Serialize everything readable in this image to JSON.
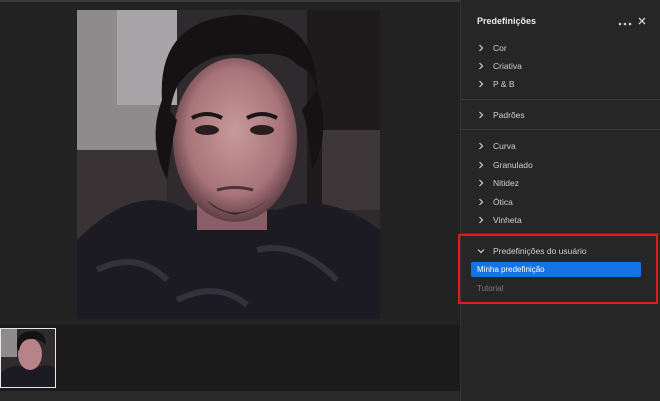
{
  "panel": {
    "title": "Predefinições",
    "more_icon": "more-horizontal-icon",
    "close_icon": "close-icon",
    "group1": [
      "Cor",
      "Criativa",
      "P & B"
    ],
    "group2": [
      "Padrões"
    ],
    "group3": [
      "Curva",
      "Granulado",
      "Nitidez",
      "Ótica",
      "Vinheta"
    ],
    "user_presets": {
      "label": "Predefinições do usuário",
      "selected": "Minha predefinição",
      "other": "Tutorial"
    }
  },
  "colors": {
    "accent": "#1473e6",
    "annotation_red": "#e01b1b"
  }
}
